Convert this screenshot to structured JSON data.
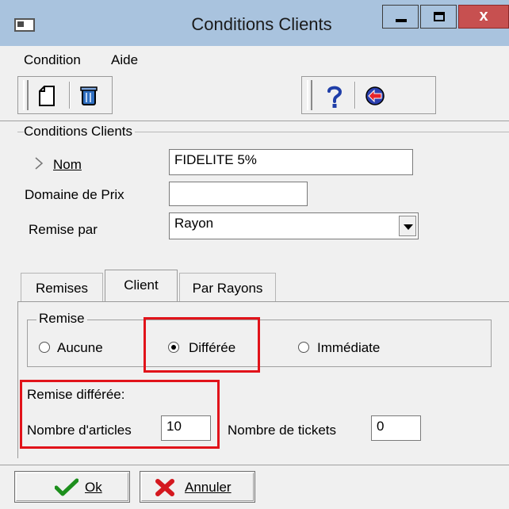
{
  "window": {
    "title": "Conditions Clients",
    "close_glyph": "x",
    "icon": "app-icon"
  },
  "menu": {
    "items": [
      "Condition",
      "Aide"
    ]
  },
  "toolbar": {
    "icons": [
      "new-document-icon",
      "delete-icon",
      "help-icon",
      "exit-icon"
    ]
  },
  "section": {
    "title": "Conditions Clients"
  },
  "form": {
    "nom_label": "Nom",
    "nom_value": "FIDELITE 5%",
    "domaine_label": "Domaine de Prix",
    "domaine_value": "",
    "remise_par_label": "Remise par",
    "remise_par_value": "Rayon"
  },
  "tabs": [
    {
      "label": "Remises",
      "active": false
    },
    {
      "label": "Client",
      "active": true
    },
    {
      "label": "Par Rayons",
      "active": false
    }
  ],
  "remise_group": {
    "title": "Remise",
    "options": [
      {
        "label": "Aucune",
        "checked": false
      },
      {
        "label": "Différée",
        "checked": true
      },
      {
        "label": "Immédiate",
        "checked": false
      }
    ]
  },
  "differee": {
    "title": "Remise différée:",
    "articles_label": "Nombre d'articles",
    "articles_value": "10",
    "tickets_label": "Nombre de tickets",
    "tickets_value": "0"
  },
  "buttons": {
    "ok": "Ok",
    "cancel": "Annuler"
  },
  "colors": {
    "highlight": "#e1131a",
    "titlebar": "#a9c3de",
    "close": "#c75050"
  }
}
